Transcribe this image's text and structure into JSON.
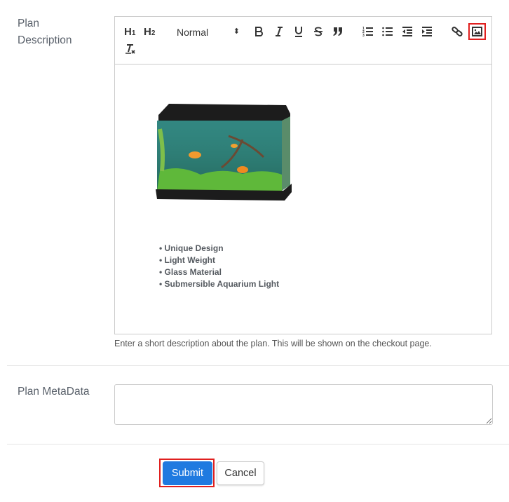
{
  "fields": {
    "description": {
      "label_line1": "Plan",
      "label_line2": "Description",
      "help_text": "Enter a short description about the plan. This will be shown on the checkout page.",
      "toolbar": {
        "h1": "H",
        "h1_sub": "1",
        "h2": "H",
        "h2_sub": "2",
        "format_select": "Normal",
        "buttons": [
          "bold",
          "italic",
          "underline",
          "strike",
          "blockquote",
          "ordered-list",
          "bullet-list",
          "outdent",
          "indent",
          "link",
          "image",
          "clean"
        ],
        "highlighted": "image"
      },
      "content": {
        "image_alt": "Aquarium",
        "features": [
          "Unique Design",
          "Light Weight",
          "Glass Material",
          "Submersible Aquarium Light"
        ]
      }
    },
    "metadata": {
      "label": "Plan MetaData",
      "value": ""
    }
  },
  "actions": {
    "submit_label": "Submit",
    "cancel_label": "Cancel",
    "submit_color": "#1f7ae0",
    "highlight_color": "#e0201f"
  }
}
